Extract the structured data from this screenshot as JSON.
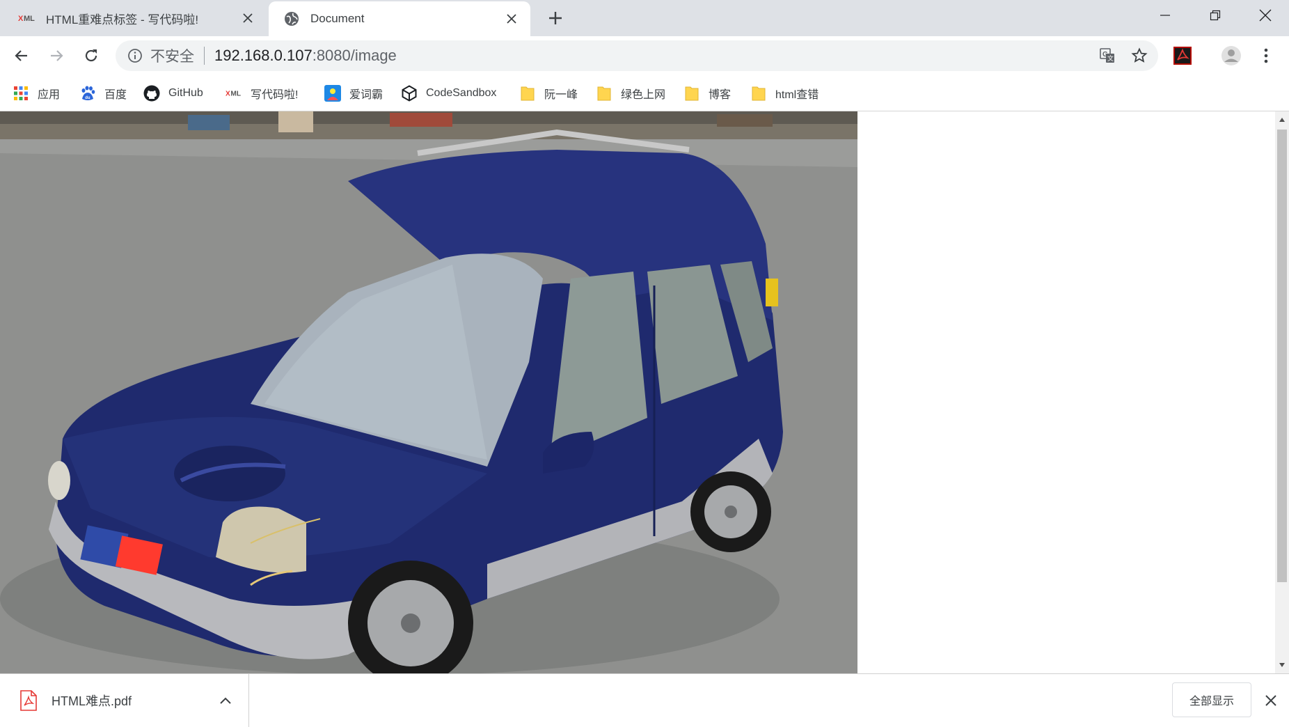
{
  "tabs": [
    {
      "label": "HTML重难点标签 - 写代码啦!",
      "favicon": "xml-icon"
    },
    {
      "label": "Document",
      "favicon": "globe-icon",
      "active": true
    }
  ],
  "address_bar": {
    "security_label": "不安全",
    "url_host": "192.168.0.107",
    "url_rest": ":8080/image"
  },
  "bookmarks": [
    {
      "label": "应用",
      "icon": "apps-grid-icon"
    },
    {
      "label": "百度",
      "icon": "baidu-paw-icon"
    },
    {
      "label": "GitHub",
      "icon": "github-icon"
    },
    {
      "label": "写代码啦!",
      "icon": "xml-icon"
    },
    {
      "label": "爱词霸",
      "icon": "iciba-icon"
    },
    {
      "label": "CodeSandbox",
      "icon": "codesandbox-icon"
    },
    {
      "label": "阮一峰",
      "icon": "folder-icon"
    },
    {
      "label": "绿色上网",
      "icon": "folder-icon"
    },
    {
      "label": "博客",
      "icon": "folder-icon"
    },
    {
      "label": "html查错",
      "icon": "folder-icon"
    }
  ],
  "content": {
    "image_subject": "blue-hatchback-car-photo"
  },
  "downloads": {
    "file_name": "HTML难点.pdf",
    "show_all_label": "全部显示"
  },
  "colors": {
    "tabstrip": "#dee1e6",
    "omnibox": "#f1f3f4",
    "car_body": "#1f2a6e"
  }
}
